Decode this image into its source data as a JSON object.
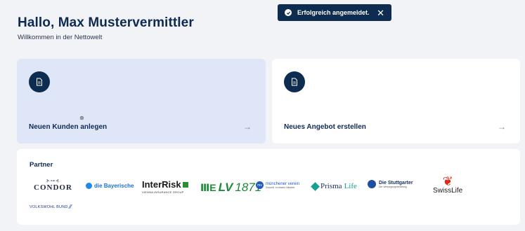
{
  "greeting": {
    "title": "Hallo, Max Mustervermittler",
    "subtitle": "Willkommen in der Nettowelt"
  },
  "toast": {
    "message": "Erfolgreich angemeldet.",
    "close": "✕",
    "icon": "check-circle-icon"
  },
  "cards": [
    {
      "label": "Neuen Kunden anlegen",
      "icon": "document-icon",
      "arrow": "→"
    },
    {
      "label": "Neues Angebot erstellen",
      "icon": "document-icon",
      "arrow": "→"
    }
  ],
  "partner": {
    "heading": "Partner",
    "logos": [
      {
        "name": "CONDOR",
        "wing": "⊱⊶⊰"
      },
      {
        "name": "die Bayerische"
      },
      {
        "name": "InterRisk",
        "sub": "VIENNA INSURANCE GROUP"
      },
      {
        "name": "LV",
        "year": "1871",
        "bars": "ⅢE"
      },
      {
        "name": "münchener verein",
        "sub": "Zukunft. In besten Händen.",
        "mark": "mv"
      },
      {
        "name": "Prisma",
        "accent": "Life"
      },
      {
        "name": "Die Stuttgarter",
        "sub": "Die Versorgungsberatung"
      },
      {
        "name": "SwissLife",
        "mark": "❦"
      },
      {
        "name": "VOLKSWOHL BUND",
        "mark": "⁄⁄"
      }
    ]
  },
  "colors": {
    "navy": "#0e2c50",
    "card_active": "#dfe6f7",
    "background": "#f2f3f7"
  }
}
